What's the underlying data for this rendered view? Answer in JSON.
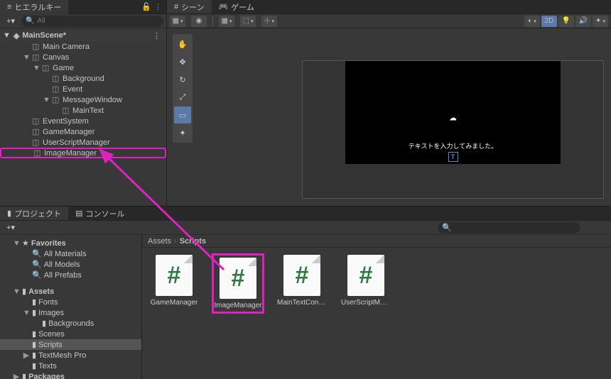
{
  "hierarchy": {
    "tab_label": "ヒエラルキー",
    "search_placeholder": "All",
    "scene": "MainScene*",
    "items": [
      {
        "label": "Main Camera",
        "indent": 2
      },
      {
        "label": "Canvas",
        "indent": 2,
        "fold": "▼"
      },
      {
        "label": "Game",
        "indent": 3,
        "fold": "▼"
      },
      {
        "label": "Background",
        "indent": 4
      },
      {
        "label": "Event",
        "indent": 4
      },
      {
        "label": "MessageWindow",
        "indent": 4,
        "fold": "▼"
      },
      {
        "label": "MainText",
        "indent": 5
      },
      {
        "label": "EventSystem",
        "indent": 2
      },
      {
        "label": "GameManager",
        "indent": 2
      },
      {
        "label": "UserScriptManager",
        "indent": 2
      },
      {
        "label": "ImageManager",
        "indent": 2,
        "selected": true
      }
    ]
  },
  "scene": {
    "tab_scene": "シーン",
    "tab_game": "ゲーム",
    "toolbar_2d": "2D",
    "canvas_text": "テキストを入力してみました。",
    "text_icon": "T"
  },
  "project": {
    "tab_project": "プロジェクト",
    "tab_console": "コンソール",
    "favorites_label": "Favorites",
    "favorites": [
      "All Materials",
      "All Models",
      "All Prefabs"
    ],
    "assets_label": "Assets",
    "folders": [
      {
        "label": "Fonts",
        "indent": 2
      },
      {
        "label": "Images",
        "indent": 2,
        "fold": "▼"
      },
      {
        "label": "Backgrounds",
        "indent": 3
      },
      {
        "label": "Scenes",
        "indent": 2
      },
      {
        "label": "Scripts",
        "indent": 2,
        "selected": true
      },
      {
        "label": "TextMesh Pro",
        "indent": 2,
        "fold": "▶"
      },
      {
        "label": "Texts",
        "indent": 2
      }
    ],
    "packages_label": "Packages",
    "breadcrumb": [
      "Assets",
      "Scripts"
    ],
    "scripts": [
      {
        "label": "GameManager"
      },
      {
        "label": "ImageManager",
        "highlighted": true
      },
      {
        "label": "MainTextCont…"
      },
      {
        "label": "UserScriptMa…"
      }
    ]
  }
}
